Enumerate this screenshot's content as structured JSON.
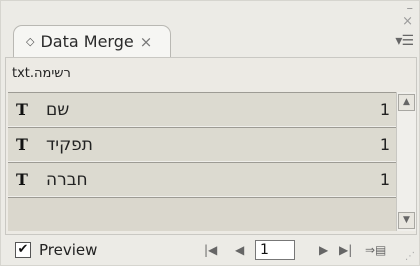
{
  "window": {
    "minimize_glyph": "–",
    "close_glyph": "×"
  },
  "tab": {
    "title": "Data Merge",
    "diamond_glyph": "◇",
    "close_glyph": "×"
  },
  "panel_menu_glyph": "▾☰",
  "data_source": "רשימה.txt",
  "fields": [
    {
      "icon": "T",
      "name": "שם",
      "value": "1"
    },
    {
      "icon": "T",
      "name": "תפקיד",
      "value": "1"
    },
    {
      "icon": "T",
      "name": "חברה",
      "value": "1"
    }
  ],
  "footer": {
    "preview_label": "Preview",
    "preview_checked": true,
    "check_glyph": "✔",
    "first_glyph": "|◀",
    "prev_glyph": "◀",
    "record": "1",
    "next_glyph": "▶",
    "last_glyph": "▶|",
    "merge_glyph": "⇒▤"
  }
}
